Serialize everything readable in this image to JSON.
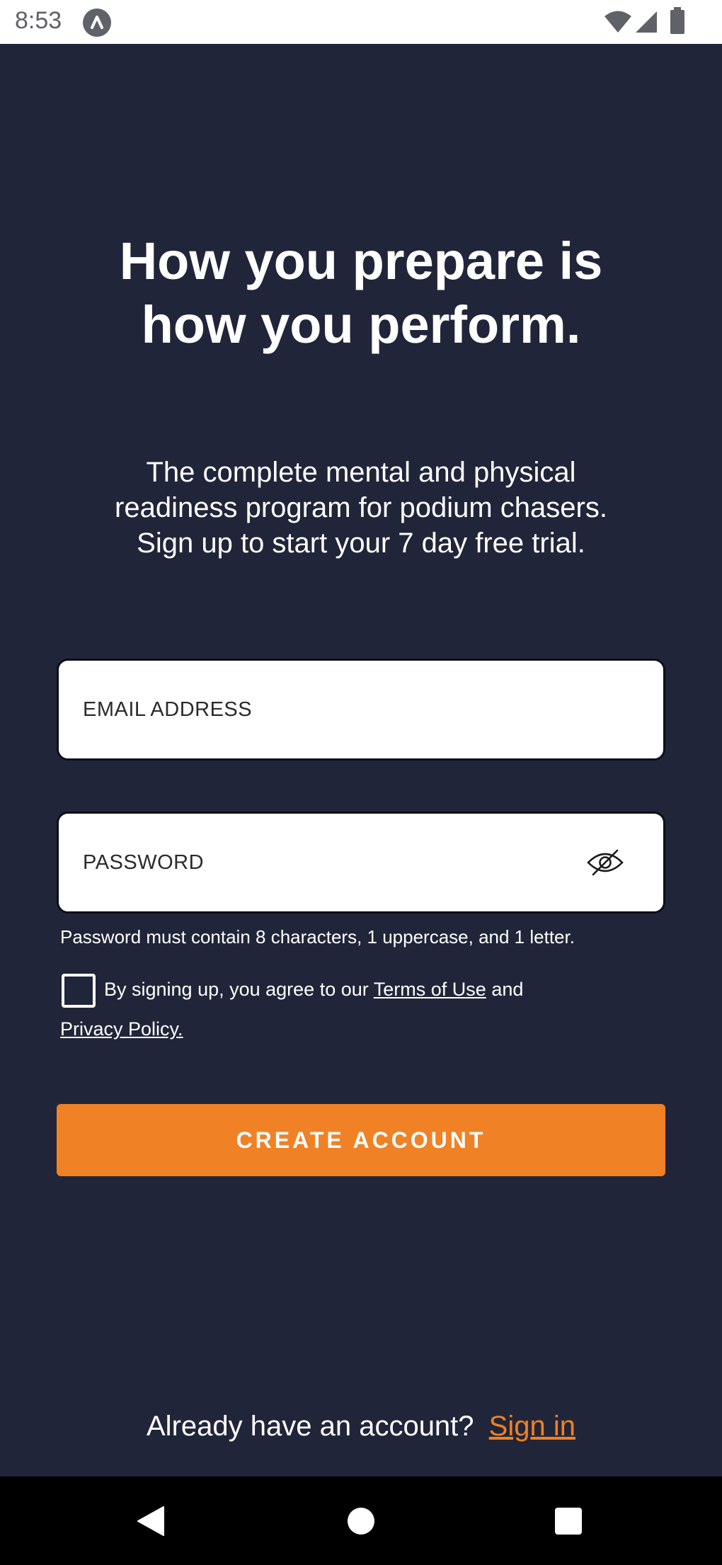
{
  "status_bar": {
    "time": "8:53"
  },
  "hero": {
    "headline_line1": "How you prepare is",
    "headline_line2": "how you perform.",
    "subtitle_line1": "The complete mental and physical",
    "subtitle_line2": "readiness program for podium chasers.",
    "subtitle_line3": "Sign up to start your 7 day free trial."
  },
  "form": {
    "email": {
      "placeholder": "EMAIL ADDRESS",
      "value": ""
    },
    "password": {
      "placeholder": "PASSWORD",
      "value": ""
    },
    "password_hint": "Password must contain 8 characters, 1 uppercase, and 1 letter.",
    "terms": {
      "prefix": "By signing up, you agree to our ",
      "terms_link": "Terms of Use",
      "and": " and",
      "privacy_link": "Privacy Policy.",
      "checked": false
    },
    "submit_label": "CREATE ACCOUNT"
  },
  "footer": {
    "prompt": "Already have an account?",
    "signin_link": "Sign in"
  },
  "colors": {
    "background": "#212539",
    "accent": "#f08124",
    "field_background": "#ffffff",
    "text": "#ffffff"
  },
  "icons": {
    "status_app": "app-notification-icon",
    "wifi": "wifi-icon",
    "signal": "cell-signal-icon",
    "battery": "battery-icon",
    "password_toggle": "eye-slash-icon",
    "nav_back": "back-triangle-icon",
    "nav_home": "home-circle-icon",
    "nav_recent": "recent-apps-square-icon"
  }
}
